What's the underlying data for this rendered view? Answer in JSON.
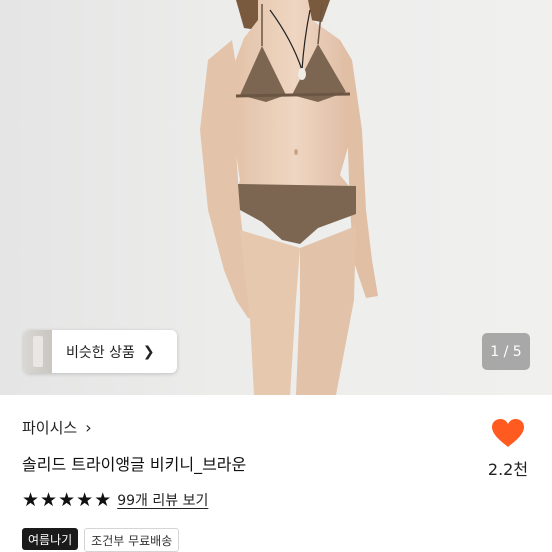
{
  "colors": {
    "heart": "#ff5a1f",
    "swimsuit": "#7d6651",
    "background": "#ebebea"
  },
  "hero": {
    "similar_button_label": "비슷한 상품",
    "page_indicator": "1 / 5"
  },
  "product": {
    "seller": "파이시스",
    "title": "솔리드 트라이앵글 비키니_브라운",
    "rating_stars": 5,
    "review_link": "99개 리뷰 보기",
    "tags": [
      "여름나기",
      "조건부 무료배송"
    ],
    "like_count": "2.2천"
  },
  "icons": {
    "similar_chevron": "chevron-right-icon",
    "seller_chevron": "chevron-right-icon",
    "star": "star-icon",
    "heart": "heart-icon"
  }
}
